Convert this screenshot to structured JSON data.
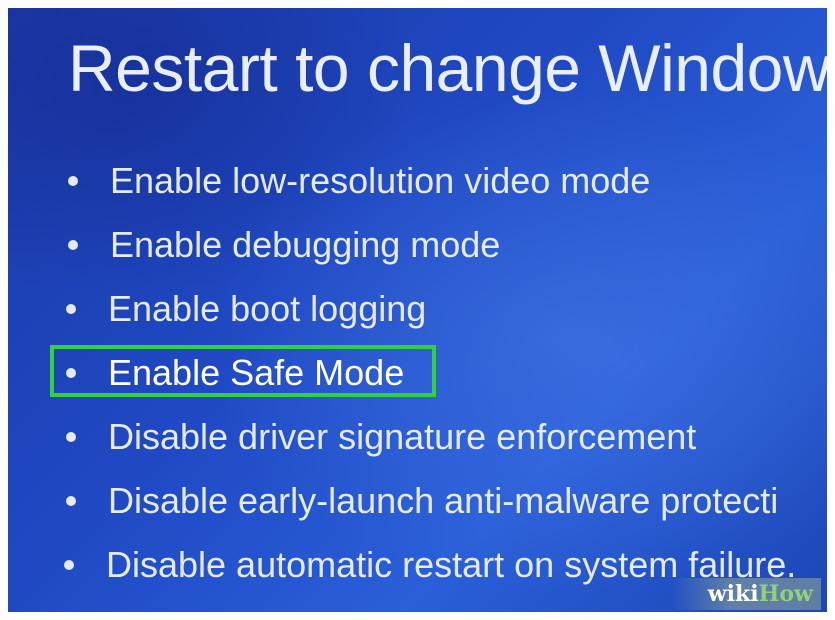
{
  "screen": {
    "title": "Restart to change Window",
    "options": [
      "Enable low-resolution video mode",
      "Enable debugging mode",
      "Enable boot logging",
      "Enable Safe Mode",
      "Disable driver signature enforcement",
      "Disable early-launch anti-malware protecti",
      "Disable automatic restart on system failure."
    ],
    "highlighted_option_index": 3
  },
  "colors": {
    "background": "#1f48c2",
    "text": "#e4eaf8",
    "highlight_border": "#33d23a"
  },
  "watermark": {
    "part1": "wiki",
    "part2": "How"
  }
}
